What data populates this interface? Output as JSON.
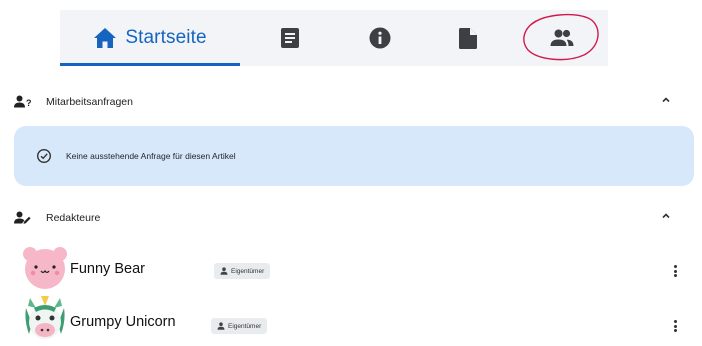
{
  "tabs": {
    "home_label": "Startseite",
    "icons": [
      "home-icon",
      "document-list-icon",
      "info-icon",
      "file-icon",
      "people-icon"
    ]
  },
  "colors": {
    "accent": "#1565c0",
    "tab_bar_bg": "#f2f4f8",
    "info_box_bg": "#d7e8fb",
    "annotation": "#d11a4a"
  },
  "collab_requests": {
    "title": "Mitarbeitsanfragen",
    "empty_message": "Keine ausstehende Anfrage für diesen Artikel"
  },
  "editors": {
    "title": "Redakteure",
    "items": [
      {
        "name": "Funny Bear",
        "role": "Eigentümer",
        "avatar": "bear-avatar-icon"
      },
      {
        "name": "Grumpy Unicorn",
        "role": "Eigentümer",
        "avatar": "unicorn-avatar-icon"
      }
    ]
  }
}
